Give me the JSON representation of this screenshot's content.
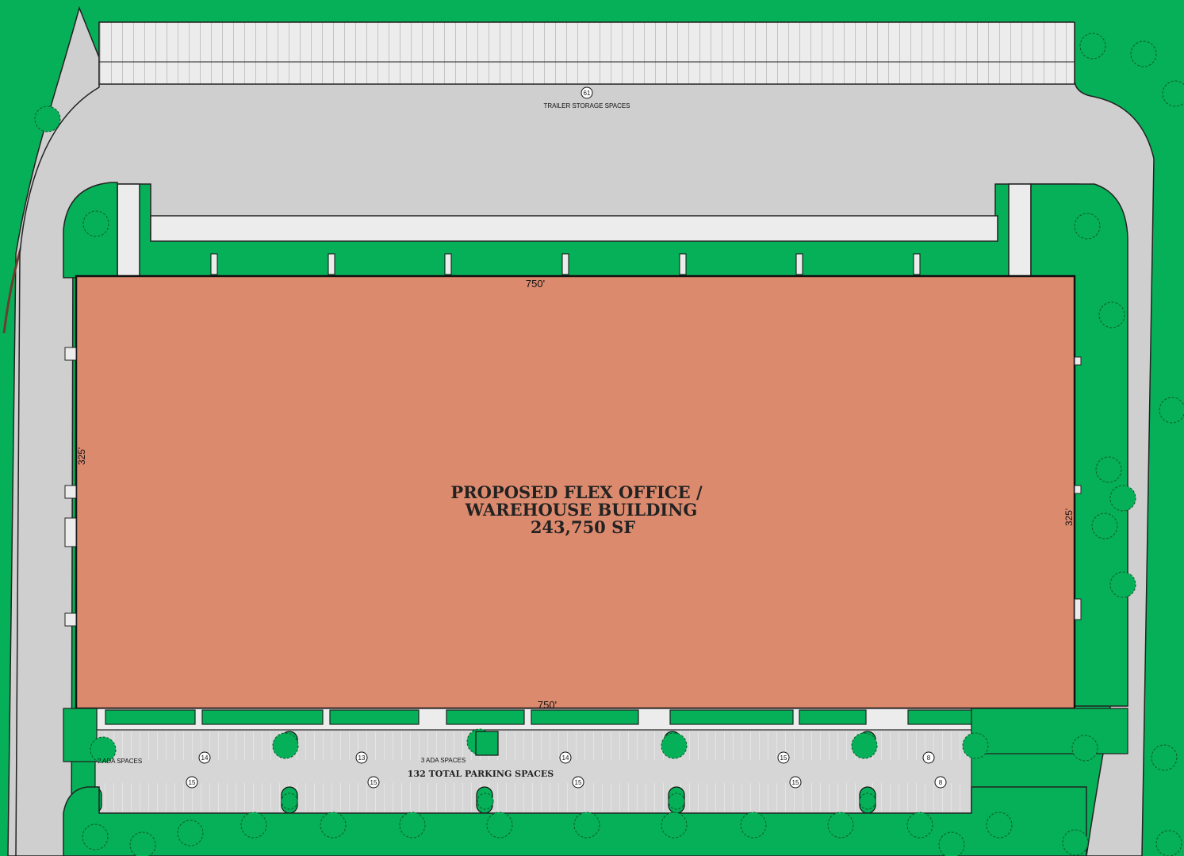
{
  "building": {
    "title_line1": "PROPOSED FLEX OFFICE /",
    "title_line2": "WAREHOUSE BUILDING",
    "area": "243,750 SF",
    "dim_length": "750'",
    "dim_width": "325'"
  },
  "trailer_storage": {
    "count": "61",
    "label": "TRAILER STORAGE SPACES"
  },
  "parking": {
    "total_label": "132 TOTAL PARKING SPACES",
    "ada_left": "2 ADA SPACES",
    "ada_center": "3 ADA SPACES",
    "row1_counts": [
      "14",
      "13",
      "14",
      "15",
      "8"
    ],
    "row2_counts": [
      "15",
      "15",
      "15",
      "15",
      "8"
    ]
  },
  "colors": {
    "grass": "#06b058",
    "pavement": "#cfcfcf",
    "building": "#dc8a6e",
    "outline": "#111111"
  }
}
